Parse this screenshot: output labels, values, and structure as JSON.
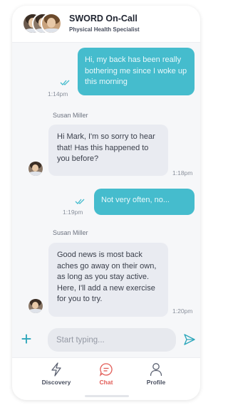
{
  "header": {
    "title": "SWORD On-Call",
    "subtitle": "Physical Health Specialist"
  },
  "messages": [
    {
      "type": "outgoing",
      "text": "Hi, my back has been really bothering me since I woke up this morning",
      "time": "1:14pm",
      "read": true
    },
    {
      "type": "incoming",
      "sender": "Susan Miller",
      "text": "Hi Mark, I'm so sorry to hear that! Has this happened to you before?",
      "time": "1:18pm"
    },
    {
      "type": "outgoing",
      "text": "Not very often, no...",
      "time": "1:19pm",
      "read": true
    },
    {
      "type": "incoming",
      "sender": "Susan Miller",
      "text": "Good news is most back aches go away on their own, as long as you stay active. Here, I'll add a new exercise for you to try.",
      "time": "1:20pm"
    }
  ],
  "composer": {
    "placeholder": "Start typing...",
    "attach_icon": "plus-icon",
    "send_icon": "send-icon"
  },
  "tabs": [
    {
      "label": "Discovery",
      "icon": "lightning-icon",
      "active": false
    },
    {
      "label": "Chat",
      "icon": "chat-icon",
      "active": true
    },
    {
      "label": "Profile",
      "icon": "person-icon",
      "active": false
    }
  ],
  "colors": {
    "outgoing_bubble": "#45bccd",
    "incoming_bubble": "#e9ebf1",
    "accent": "#2ea7bb",
    "active_tab": "#e25b56"
  }
}
